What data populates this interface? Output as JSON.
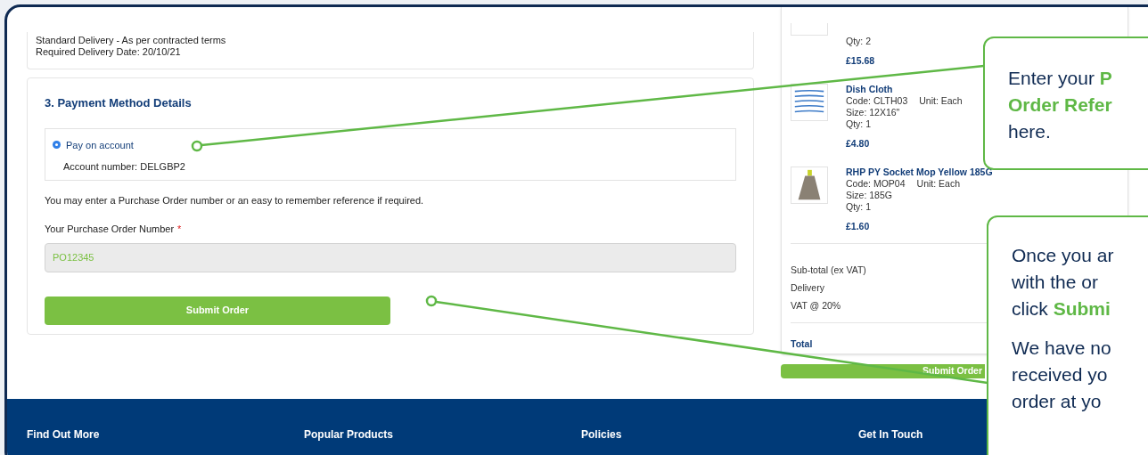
{
  "delivery": {
    "lines": [
      "Standard Delivery  -  As per contracted terms",
      "Required Delivery Date:  20/10/21"
    ]
  },
  "payment": {
    "title": "3. Payment Method Details",
    "options": [
      {
        "label": "Pay on account",
        "selected": true,
        "detail": "Account number: DELGBP2"
      }
    ],
    "note": "You may enter a Purchase Order number or an easy to remember reference if required.",
    "po_label": "Your Purchase Order Number",
    "required_mark": "*",
    "po_value": "PO12345",
    "submit": "Submit Order"
  },
  "cart": {
    "items": [
      {
        "kind": "cut",
        "qty": "Qty: 2",
        "price": "£15.68"
      },
      {
        "kind": "cloth",
        "name": "Dish Cloth",
        "code": "Code: CLTH03",
        "unit": "Unit: Each",
        "size": "Size: 12X16\"",
        "qty": "Qty: 1",
        "price": "£4.80"
      },
      {
        "kind": "mop",
        "name": "RHP PY Socket Mop Yellow 185G",
        "code": "Code: MOP04",
        "unit": "Unit: Each",
        "size": "Size: 185G",
        "qty": "Qty: 1",
        "price": "£1.60"
      }
    ],
    "summary": [
      "Sub-total (ex VAT)",
      "Delivery",
      "VAT @ 20%"
    ],
    "total": "Total",
    "submit": "Submit Order"
  },
  "footer": {
    "headings": [
      "Find Out More",
      "Popular Products",
      "Policies",
      "Get In Touch"
    ]
  },
  "callouts": [
    {
      "paragraphs": [
        [
          "Enter your **P**",
          "**Order Refer**",
          "here."
        ]
      ]
    },
    {
      "paragraphs": [
        [
          "Once you ar",
          "with the or",
          "click **Submi**"
        ],
        [
          "We have no",
          "received yo",
          "order at yo"
        ]
      ]
    }
  ]
}
